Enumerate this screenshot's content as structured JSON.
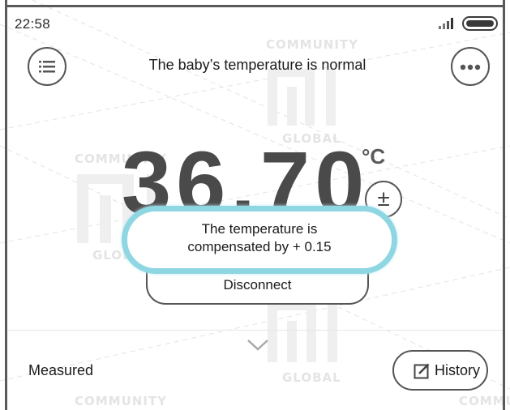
{
  "status_bar": {
    "time": "22:58",
    "signal_icon": "signal-icon",
    "battery_icon": "battery-icon"
  },
  "header": {
    "title": "The baby’s temperature is normal",
    "menu_icon": "menu-icon",
    "more_icon": "more-icon"
  },
  "reading": {
    "value": "36.70",
    "unit": "°C",
    "compensate_symbol": "±"
  },
  "toast": {
    "line1": "The temperature is",
    "line2": "compensated by + 0.15",
    "border_color": "#8fd6e3"
  },
  "actions": {
    "disconnect_label": "Disconnect"
  },
  "footer": {
    "measured_label": "Measured",
    "history_label": "History",
    "history_icon": "edit-icon"
  },
  "watermark": {
    "top": "COMMUNITY",
    "bottom": "GLOBAL"
  }
}
